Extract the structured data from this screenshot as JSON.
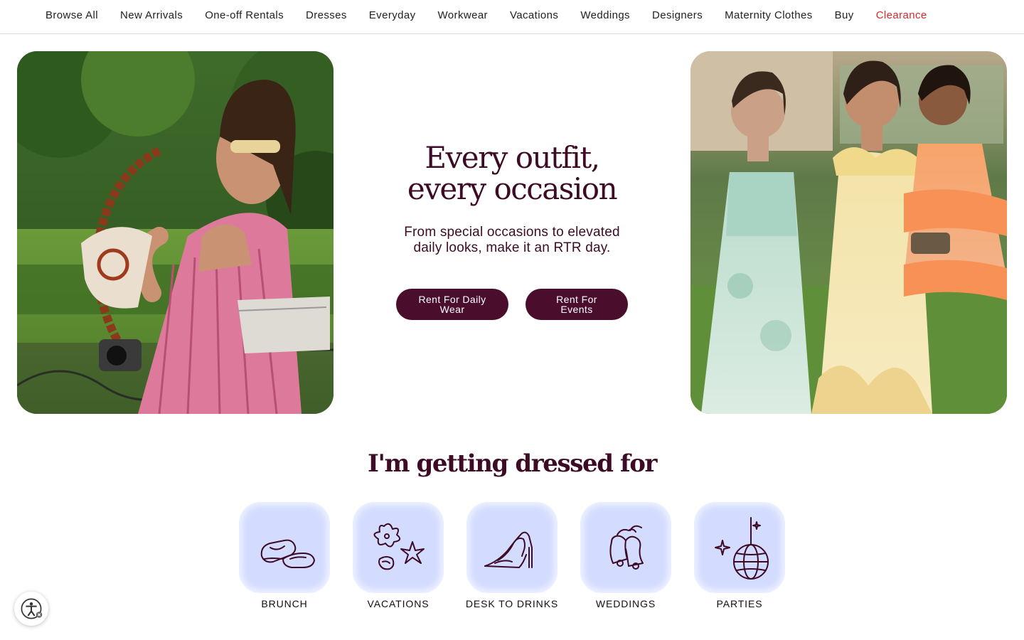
{
  "nav": {
    "items": [
      "Browse All",
      "New Arrivals",
      "One-off Rentals",
      "Dresses",
      "Everyday",
      "Workwear",
      "Vacations",
      "Weddings",
      "Designers",
      "Maternity Clothes",
      "Buy",
      "Clearance"
    ],
    "sale_color": "#d62b2b"
  },
  "hero": {
    "title": "Every outfit, every occasion",
    "subtitle": "From special occasions to elevated daily looks, make it an RTR day.",
    "buttons": {
      "daily": "Rent For Daily Wear",
      "events": "Rent For Events"
    },
    "accent_color": "#4a0d2c"
  },
  "occasions": {
    "title": "I'm getting dressed for",
    "tile_color": "#d3dcff",
    "items": [
      {
        "label": "BRUNCH",
        "icon": "loafers-icon"
      },
      {
        "label": "VACATIONS",
        "icon": "hibiscus-starfish-icon"
      },
      {
        "label": "DESK TO DRINKS",
        "icon": "high-heels-icon"
      },
      {
        "label": "WEDDINGS",
        "icon": "wedding-bells-icon"
      },
      {
        "label": "PARTIES",
        "icon": "disco-ball-icon"
      }
    ]
  },
  "accessibility": {
    "icon": "accessibility-icon"
  }
}
